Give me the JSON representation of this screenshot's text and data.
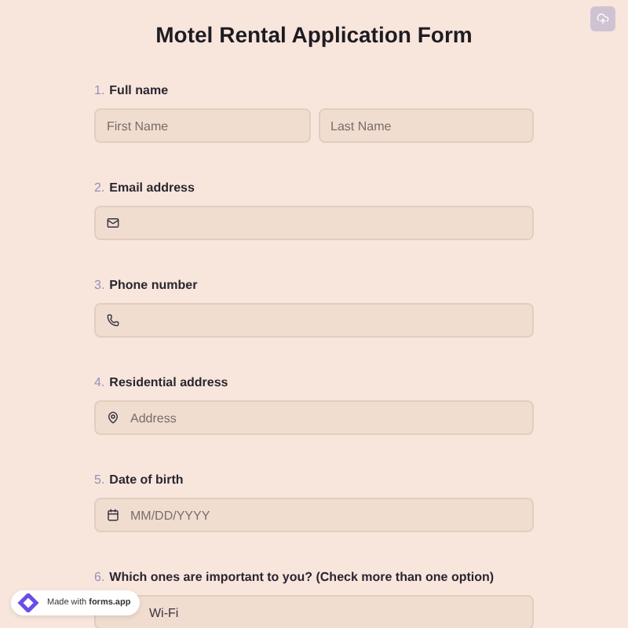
{
  "title": "Motel Rental Application Form",
  "questions": [
    {
      "number": "1.",
      "label": "Full name",
      "kind": "name",
      "fields": [
        {
          "placeholder": "First Name"
        },
        {
          "placeholder": "Last Name"
        }
      ]
    },
    {
      "number": "2.",
      "label": "Email address",
      "kind": "email"
    },
    {
      "number": "3.",
      "label": "Phone number",
      "kind": "phone"
    },
    {
      "number": "4.",
      "label": "Residential address",
      "kind": "address",
      "fields": [
        {
          "placeholder": "Address"
        }
      ]
    },
    {
      "number": "5.",
      "label": "Date of birth",
      "kind": "date",
      "fields": [
        {
          "placeholder": "MM/DD/YYYY"
        }
      ]
    },
    {
      "number": "6.",
      "label": "Which ones are important to you? (Check more than one option)",
      "kind": "choice",
      "options": [
        {
          "label": "Wi-Fi"
        }
      ]
    }
  ],
  "badge": "Made with **forms.app**"
}
